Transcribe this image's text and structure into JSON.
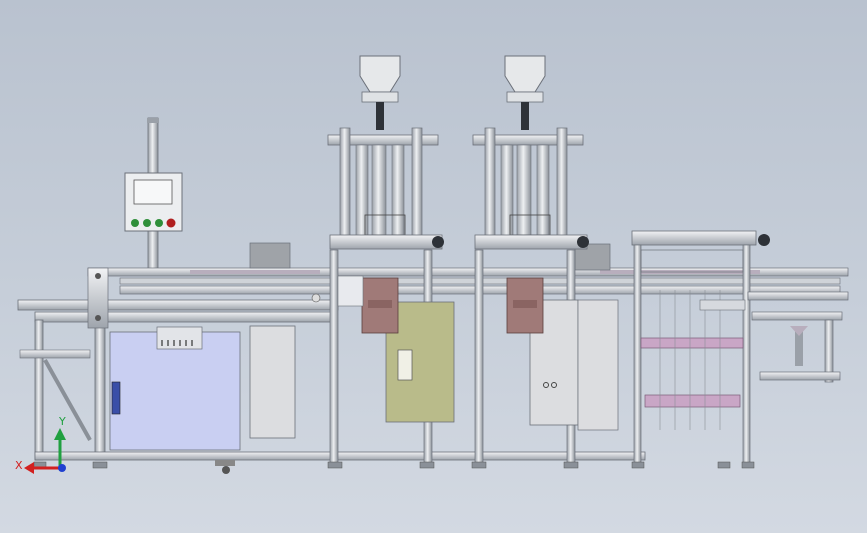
{
  "viewport": {
    "background_top": "#b9c2cf",
    "background_bottom": "#d3d9e2"
  },
  "colors": {
    "frame": "#d7dbe0",
    "frame_edge": "#6b7079",
    "cabinet_blue": "#c9cff2",
    "cabinet_olive": "#b9bb8a",
    "cabinet_grey": "#dcdde0",
    "motor_brown": "#a07a78",
    "lift_pink": "#c9a6c6",
    "hopper": "#e6e8ea",
    "dark": "#2e3238",
    "button_green": "#2f8f3a",
    "button_red": "#b02020"
  },
  "triad": {
    "x_label": "X",
    "y_label": "Y",
    "x_color": "#d22020",
    "y_color": "#20a040",
    "z_color": "#2040d0"
  },
  "components": {
    "hmi_panel": "hmi-panel",
    "hopper_left": "hopper",
    "hopper_right": "hopper",
    "conveyor": "conveyor-rail"
  }
}
